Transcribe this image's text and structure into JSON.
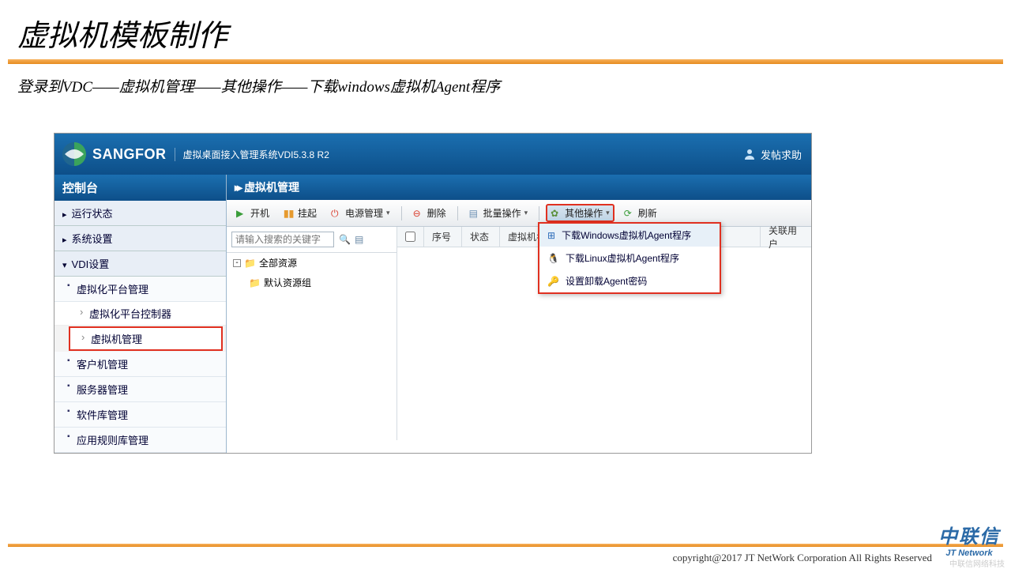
{
  "slide": {
    "title": "虚拟机模板制作",
    "subtitle": "登录到VDC——虚拟机管理——其他操作——下载windows虚拟机Agent程序"
  },
  "header": {
    "brand": "SANGFOR",
    "system": "虚拟桌面接入管理系统VDI5.3.8 R2",
    "help": "发帖求助"
  },
  "sidebar": {
    "title": "控制台",
    "sections": {
      "running": "运行状态",
      "system": "系统设置",
      "vdi": "VDI设置"
    },
    "vdi_items": {
      "platform": "虚拟化平台管理",
      "controller": "虚拟化平台控制器",
      "vm": "虚拟机管理",
      "client": "客户机管理",
      "server": "服务器管理",
      "softlib": "软件库管理",
      "rules": "应用规则库管理"
    }
  },
  "panel": {
    "title": "虚拟机管理",
    "toolbar": {
      "poweron": "开机",
      "suspend": "挂起",
      "powermgmt": "电源管理",
      "delete": "删除",
      "batch": "批量操作",
      "other": "其他操作",
      "refresh": "刷新"
    },
    "search": {
      "placeholder": "请输入搜索的关键字"
    },
    "tree": {
      "root": "全部资源",
      "group": "默认资源组"
    },
    "grid": {
      "seq": "序号",
      "status": "状态",
      "vmname": "虚拟机名",
      "relateduser": "关联用户"
    }
  },
  "dropdown": {
    "win_agent": "下载Windows虚拟机Agent程序",
    "linux_agent": "下载Linux虚拟机Agent程序",
    "set_pwd": "设置卸载Agent密码"
  },
  "footer": {
    "copyright": "copyright@2017  JT NetWork Corporation All Rights Reserved",
    "corp_cn": "中联信",
    "corp_en": "JT Network",
    "watermark": "中联信网络科技"
  }
}
